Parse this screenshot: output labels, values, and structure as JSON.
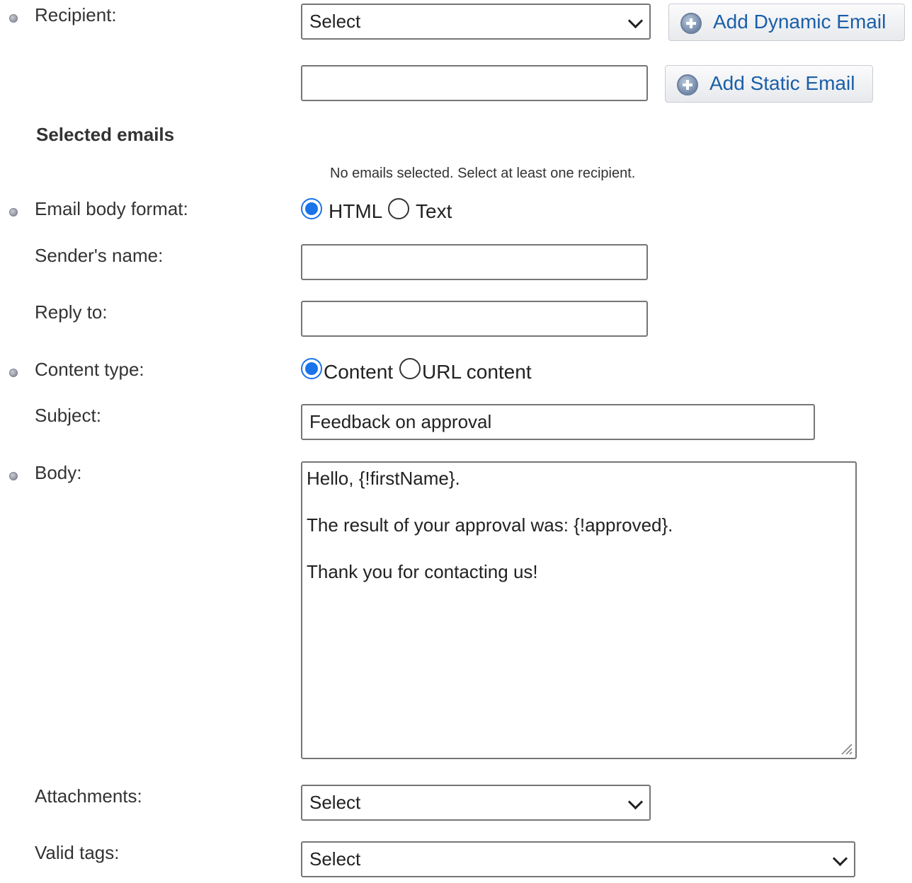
{
  "recipient": {
    "label": "Recipient:",
    "select_value": "Select",
    "static_email_value": "",
    "add_dynamic_label": "Add Dynamic Email",
    "add_static_label": "Add Static Email"
  },
  "selected_emails": {
    "heading": "Selected emails",
    "empty_message": "No emails selected. Select at least one recipient."
  },
  "email_body_format": {
    "label": "Email body format:",
    "options": [
      {
        "label": "HTML",
        "checked": true
      },
      {
        "label": "Text",
        "checked": false
      }
    ]
  },
  "senders_name": {
    "label": "Sender's name:",
    "value": ""
  },
  "reply_to": {
    "label": "Reply to:",
    "value": ""
  },
  "content_type": {
    "label": "Content type:",
    "options": [
      {
        "label": "Content",
        "checked": true
      },
      {
        "label": "URL content",
        "checked": false
      }
    ]
  },
  "subject": {
    "label": "Subject:",
    "value": "Feedback on approval"
  },
  "body": {
    "label": "Body:",
    "lines": [
      "Hello, {!firstName}.",
      "The result of your approval was: {!approved}.",
      "Thank you for contacting us!"
    ]
  },
  "attachments": {
    "label": "Attachments:",
    "select_value": "Select"
  },
  "valid_tags": {
    "label": "Valid tags:",
    "select_value": "Select"
  },
  "colors": {
    "link_blue": "#1a5fa8",
    "radio_checked": "#1a73e8",
    "border_gray": "#767676",
    "label_text": "#333333"
  },
  "icons": {
    "required_marker": "required-bullet-icon",
    "add": "add-circle-icon",
    "dropdown": "chevron-down-icon",
    "resize": "resize-grip-icon"
  }
}
